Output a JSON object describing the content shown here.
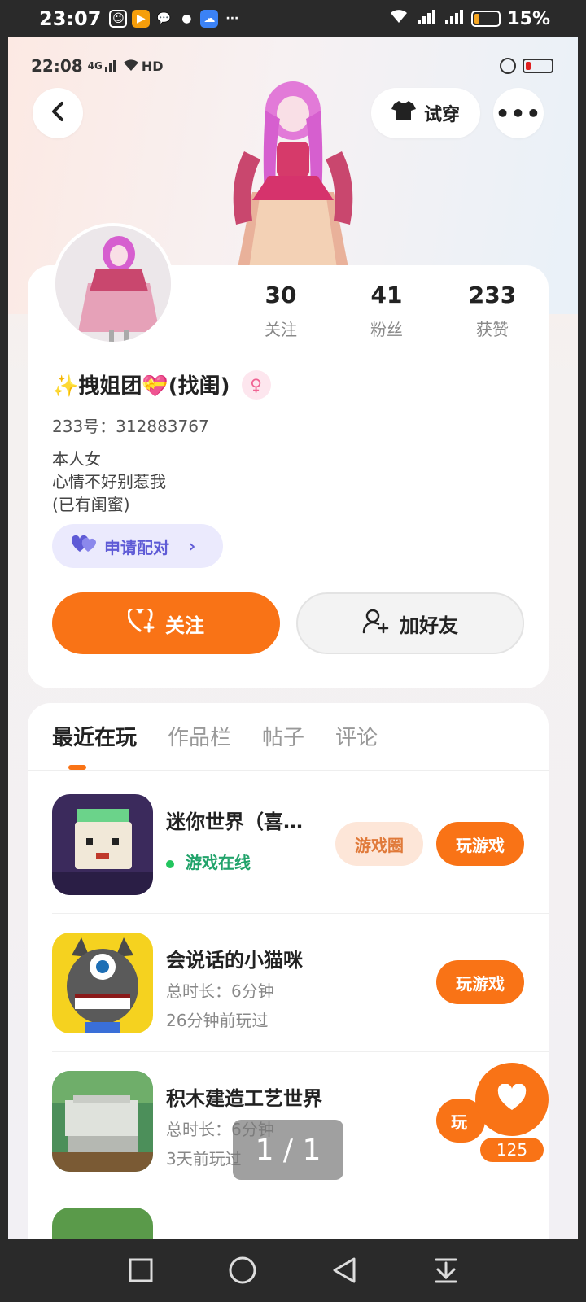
{
  "outer_status": {
    "time": "23:07",
    "battery": "15%"
  },
  "inner_status": {
    "time": "22:08",
    "network": "4G",
    "hd": "HD"
  },
  "header": {
    "try_on_label": "试穿"
  },
  "profile": {
    "stats": [
      {
        "value": "30",
        "label": "关注"
      },
      {
        "value": "41",
        "label": "粉丝"
      },
      {
        "value": "233",
        "label": "获赞"
      }
    ],
    "nickname": "✨拽姐团💝(找闺)",
    "gender_icon": "female-icon",
    "uid": "233号：312883767",
    "bio": [
      "本人女",
      "心情不好别惹我",
      "(已有闺蜜)"
    ],
    "pair_label": "申请配对",
    "follow_label": "关注",
    "add_friend_label": "加好友"
  },
  "tabs": [
    {
      "label": "最近在玩",
      "active": true
    },
    {
      "label": "作品栏",
      "active": false
    },
    {
      "label": "帖子",
      "active": false
    },
    {
      "label": "评论",
      "active": false
    }
  ],
  "games": [
    {
      "title": "迷你世界（喜…",
      "status": "游戏在线",
      "circle_label": "游戏圈",
      "play_label": "玩游戏"
    },
    {
      "title": "会说话的小猫咪",
      "duration": "总时长：6分钟",
      "last_played": "26分钟前玩过",
      "play_label": "玩游戏"
    },
    {
      "title": "积木建造工艺世界",
      "duration": "总时长：6分钟",
      "last_played": "3天前玩过",
      "play_label": "玩"
    }
  ],
  "like_count": "125",
  "page_indicator": "1 / 1",
  "colors": {
    "accent": "#f97316",
    "pair_chip_bg": "#ebeafd",
    "pair_chip_text": "#5f5bd6",
    "online_green": "#22a36b"
  }
}
